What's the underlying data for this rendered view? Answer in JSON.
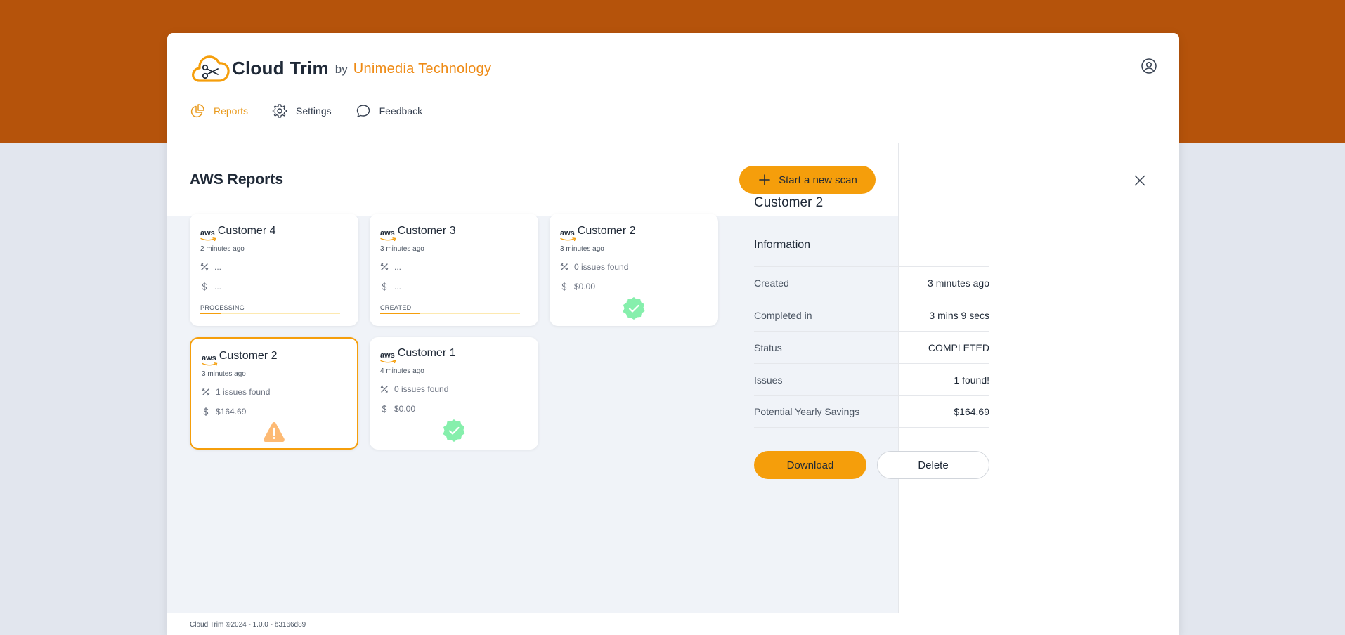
{
  "brand": {
    "name": "Cloud Trim",
    "by": "by",
    "company": "Unimedia Technology",
    "accent": "#ee8a14"
  },
  "colors": {
    "band": "#b5530b",
    "primary": "#f59e0b",
    "success": "#86efac",
    "warning": "#fdba74"
  },
  "nav": [
    {
      "label": "Reports",
      "icon": "pie-chart-icon",
      "active": true
    },
    {
      "label": "Settings",
      "icon": "gear-icon",
      "active": false
    },
    {
      "label": "Feedback",
      "icon": "chat-bubble-icon",
      "active": false
    }
  ],
  "header": {
    "user_icon": "user-circle-icon"
  },
  "main": {
    "title": "AWS Reports",
    "scan_button": "Start a new scan",
    "cards": [
      {
        "logo": "aws",
        "name": "Customer 4",
        "time": "2 minutes ago",
        "issues": "...",
        "savings": "...",
        "status_label": "PROCESSING",
        "progress": 0.15
      },
      {
        "logo": "aws",
        "name": "Customer 3",
        "time": "3 minutes ago",
        "issues": "...",
        "savings": "...",
        "status_label": "CREATED",
        "progress": 0.28
      },
      {
        "logo": "aws",
        "name": "Customer 2",
        "time": "3 minutes ago",
        "issues": "0 issues found",
        "savings": "$0.00",
        "status": "success"
      },
      {
        "logo": "aws",
        "name": "Customer 2",
        "time": "3 minutes ago",
        "issues": "1 issues found",
        "savings": "$164.69",
        "status": "warning",
        "selected": true
      },
      {
        "logo": "aws",
        "name": "Customer 1",
        "time": "4 minutes ago",
        "issues": "0 issues found",
        "savings": "$0.00",
        "status": "success"
      }
    ]
  },
  "details": {
    "title": "Customer 2",
    "section": "Information",
    "rows": [
      {
        "label": "Created",
        "value": "3 minutes ago"
      },
      {
        "label": "Completed in",
        "value": "3 mins 9 secs"
      },
      {
        "label": "Status",
        "value": "COMPLETED"
      },
      {
        "label": "Issues",
        "value": "1 found!"
      },
      {
        "label": "Potential Yearly Savings",
        "value": "$164.69"
      }
    ],
    "download": "Download",
    "delete": "Delete"
  },
  "footer": {
    "text": "Cloud Trim ©2024 - 1.0.0 - b3166d89"
  }
}
